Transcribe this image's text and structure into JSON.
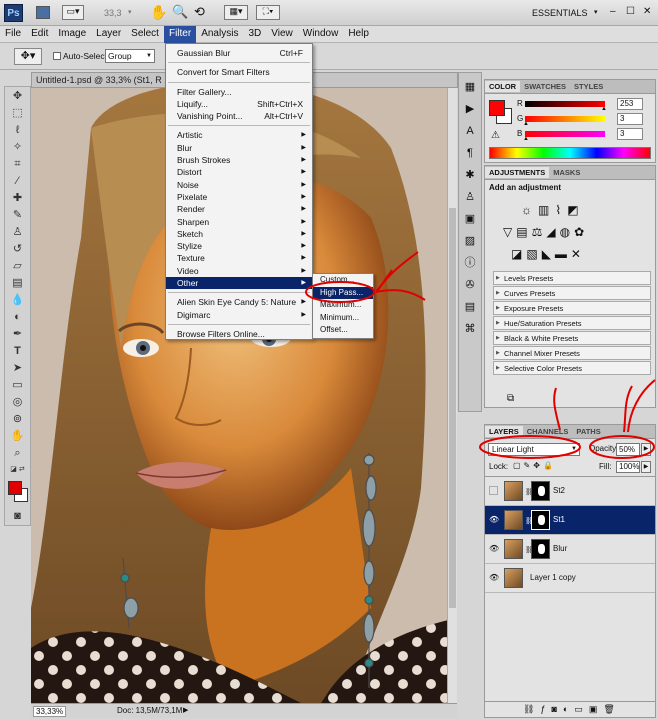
{
  "app": {
    "logo": "Ps",
    "zoom": "33,3",
    "workspace": "ESSENTIALS",
    "window_controls": [
      "–",
      "☐",
      "✕"
    ]
  },
  "menu": [
    "File",
    "Edit",
    "Image",
    "Layer",
    "Select",
    "Filter",
    "Analysis",
    "3D",
    "View",
    "Window",
    "Help"
  ],
  "options": {
    "auto_select": "Auto-Select:",
    "auto_select_value": "Group"
  },
  "document": {
    "tab": "Untitled-1.psd @ 33,3% (St1, R"
  },
  "status": {
    "zoom": "33,33%",
    "doc": "Doc: 13,5M/73,1M"
  },
  "filter_menu": {
    "items": [
      {
        "label": "Gaussian Blur",
        "shortcut": "Ctrl+F"
      },
      {
        "sep": true
      },
      {
        "label": "Convert for Smart Filters"
      },
      {
        "sep": true
      },
      {
        "label": "Filter Gallery..."
      },
      {
        "label": "Liquify...",
        "shortcut": "Shift+Ctrl+X"
      },
      {
        "label": "Vanishing Point...",
        "shortcut": "Alt+Ctrl+V"
      },
      {
        "sep": true
      },
      {
        "label": "Artistic",
        "sub": true
      },
      {
        "label": "Blur",
        "sub": true
      },
      {
        "label": "Brush Strokes",
        "sub": true
      },
      {
        "label": "Distort",
        "sub": true
      },
      {
        "label": "Noise",
        "sub": true
      },
      {
        "label": "Pixelate",
        "sub": true
      },
      {
        "label": "Render",
        "sub": true
      },
      {
        "label": "Sharpen",
        "sub": true
      },
      {
        "label": "Sketch",
        "sub": true
      },
      {
        "label": "Stylize",
        "sub": true
      },
      {
        "label": "Texture",
        "sub": true
      },
      {
        "label": "Video",
        "sub": true
      },
      {
        "label": "Other",
        "sub": true,
        "highlight": true
      },
      {
        "sep": true
      },
      {
        "label": "Alien Skin Eye Candy 5: Nature",
        "sub": true
      },
      {
        "label": "Digimarc",
        "sub": true
      },
      {
        "sep": true
      },
      {
        "label": "Browse Filters Online..."
      }
    ]
  },
  "other_submenu": [
    {
      "label": "Custom..."
    },
    {
      "label": "High Pass...",
      "highlight": true
    },
    {
      "label": "Maximum..."
    },
    {
      "label": "Minimum..."
    },
    {
      "label": "Offset..."
    }
  ],
  "color_panel": {
    "tabs": [
      "COLOR",
      "SWATCHES",
      "STYLES"
    ],
    "channels": [
      {
        "name": "R",
        "value": "253",
        "color": "#ff2020"
      },
      {
        "name": "G",
        "value": "3",
        "color": "#30c030"
      },
      {
        "name": "B",
        "value": "3",
        "color": "#3030ff"
      }
    ],
    "foreground": "#fd0303"
  },
  "adjustments_panel": {
    "tabs": [
      "ADJUSTMENTS",
      "MASKS"
    ],
    "heading": "Add an adjustment",
    "presets": [
      "Levels Presets",
      "Curves Presets",
      "Exposure Presets",
      "Hue/Saturation Presets",
      "Black & White Presets",
      "Channel Mixer Presets",
      "Selective Color Presets"
    ]
  },
  "layers_panel": {
    "tabs": [
      "LAYERS",
      "CHANNELS",
      "PATHS"
    ],
    "blend_mode": "Linear Light",
    "opacity_label": "Opacity:",
    "opacity": "50%",
    "lock_label": "Lock:",
    "fill_label": "Fill:",
    "fill": "100%",
    "layers": [
      {
        "name": "St2",
        "visible": false,
        "selected": false,
        "mask": true
      },
      {
        "name": "St1",
        "visible": true,
        "selected": true,
        "mask": true
      },
      {
        "name": "Blur",
        "visible": true,
        "selected": false,
        "mask": true
      },
      {
        "name": "Layer 1 copy",
        "visible": true,
        "selected": false,
        "mask": false
      }
    ]
  }
}
